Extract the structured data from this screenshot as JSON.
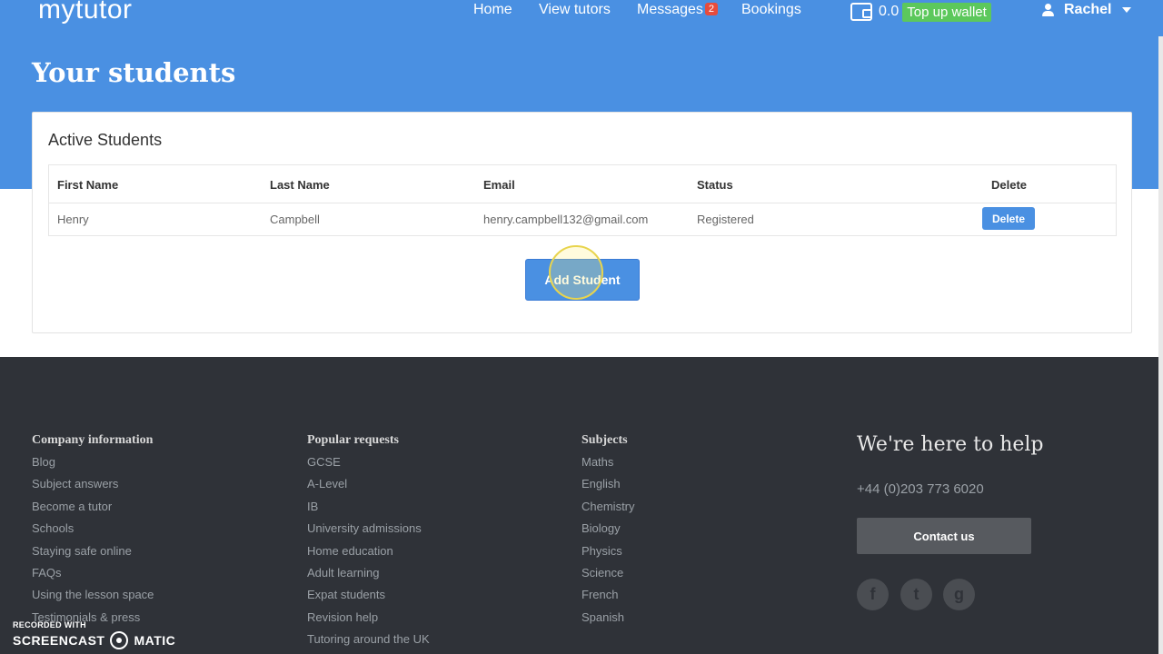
{
  "header": {
    "logo": "mytutor",
    "nav": [
      {
        "label": "Home"
      },
      {
        "label": "View tutors"
      },
      {
        "label": "Messages",
        "badge": "2"
      },
      {
        "label": "Bookings"
      }
    ],
    "wallet_amount": "0.0",
    "topup_label": "Top up wallet",
    "user_name": "Rachel"
  },
  "page": {
    "title": "Your students",
    "card_title": "Active Students",
    "columns": [
      "First Name",
      "Last Name",
      "Email",
      "Status",
      "Delete"
    ],
    "rows": [
      {
        "first": "Henry",
        "last": "Campbell",
        "email": "henry.campbell132@gmail.com",
        "status": "Registered",
        "action": "Delete"
      }
    ],
    "add_button": "Add Student"
  },
  "footer": {
    "columns": [
      {
        "heading": "Company information",
        "links": [
          "Blog",
          "Subject answers",
          "Become a tutor",
          "Schools",
          "Staying safe online",
          "FAQs",
          "Using the lesson space",
          "Testimonials & press"
        ]
      },
      {
        "heading": "Popular requests",
        "links": [
          "GCSE",
          "A-Level",
          "IB",
          "University admissions",
          "Home education",
          "Adult learning",
          "Expat students",
          "Revision help",
          "Tutoring around the UK"
        ]
      },
      {
        "heading": "Subjects",
        "links": [
          "Maths",
          "English",
          "Chemistry",
          "Biology",
          "Physics",
          "Science",
          "French",
          "Spanish"
        ]
      }
    ],
    "help_title": "We're here to help",
    "phone": "+44 (0)203 773 6020",
    "contact_button": "Contact us",
    "social": [
      "facebook-icon",
      "twitter-icon",
      "google-icon"
    ]
  },
  "watermark": {
    "line1": "RECORDED WITH",
    "part1": "SCREENCAST",
    "part2": "MATIC"
  },
  "colors": {
    "brand_blue": "#4a90e2",
    "topup_green": "#5cc85c",
    "footer_bg": "#2f3238",
    "badge_red": "#e74c3c"
  }
}
